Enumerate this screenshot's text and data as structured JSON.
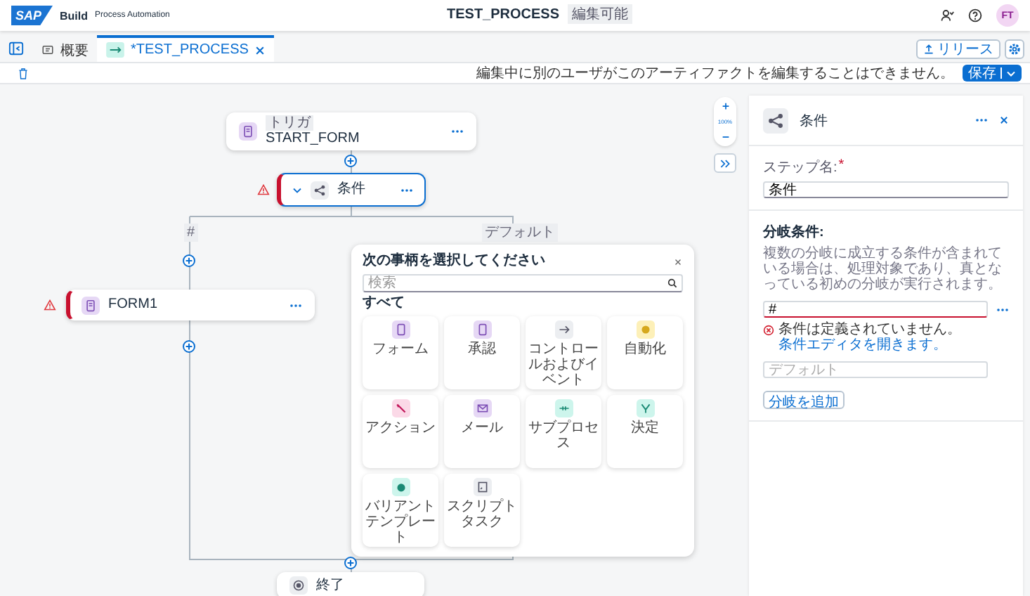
{
  "header": {
    "logo": "SAP",
    "product": "Build",
    "subtitle": "Process Automation",
    "title": "TEST_PROCESS",
    "badge": "編集可能",
    "avatar": "FT"
  },
  "tabs": [
    {
      "label": "概要",
      "selected": false,
      "closable": false
    },
    {
      "label": "*TEST_PROCESS",
      "selected": true,
      "closable": true
    }
  ],
  "release_button": "リリース",
  "toolbar": {
    "message": "編集中に別のユーザがこのアーティファクトを編集することはできません。",
    "save_button": "保存"
  },
  "canvas": {
    "zoom": "100%",
    "nodes": [
      {
        "kind": "trigger",
        "tag": "トリガ",
        "label": "START_FORM",
        "warning": false,
        "selected": false
      },
      {
        "kind": "condition",
        "label": "条件",
        "warning": true,
        "selected": true
      },
      {
        "kind": "form",
        "label": "FORM1",
        "warning": true,
        "selected": false
      },
      {
        "kind": "end",
        "label": "終了",
        "warning": false,
        "selected": false
      }
    ],
    "branch_labels": [
      "#",
      "デフォルト"
    ]
  },
  "picker": {
    "title": "次の事柄を選択してください",
    "search_placeholder": "検索",
    "section": "すべて",
    "items": [
      {
        "kind": "form",
        "label": "フォーム",
        "color": "#e6d8f5"
      },
      {
        "kind": "form",
        "label": "承認",
        "color": "#e6d8f5"
      },
      {
        "kind": "arrow",
        "label": "コントロールおよびイベント",
        "color": "#eceef1"
      },
      {
        "kind": "robot",
        "label": "自動化",
        "color": "#fdf0b8"
      },
      {
        "kind": "action",
        "label": "アクション",
        "color": "#fbd9e7"
      },
      {
        "kind": "mail",
        "label": "メール",
        "color": "#e6d8f5"
      },
      {
        "kind": "sub",
        "label": "サブプロセス",
        "color": "#cdf5ec"
      },
      {
        "kind": "decision",
        "label": "決定",
        "color": "#cdf5ec"
      },
      {
        "kind": "variant",
        "label": "バリアントテンプレート",
        "color": "#cdf5ec"
      },
      {
        "kind": "script",
        "label": "スクリプトタスク",
        "color": "#eceef1"
      }
    ]
  },
  "panel": {
    "title": "条件",
    "step_name_label": "ステップ名:",
    "required_mark": "*",
    "step_name_value": "条件",
    "branch_heading": "分岐条件:",
    "branch_description": "複数の分岐に成立する条件が含まれている場合は、処理対象であり、真となっている初めの分岐が実行されます。",
    "branches": [
      {
        "value": "#",
        "error": true
      }
    ],
    "error_text": "条件は定義されていません。",
    "error_link": "条件エディタを開きます。",
    "default_placeholder": "デフォルト",
    "add_branch_button": "分岐を追加"
  }
}
